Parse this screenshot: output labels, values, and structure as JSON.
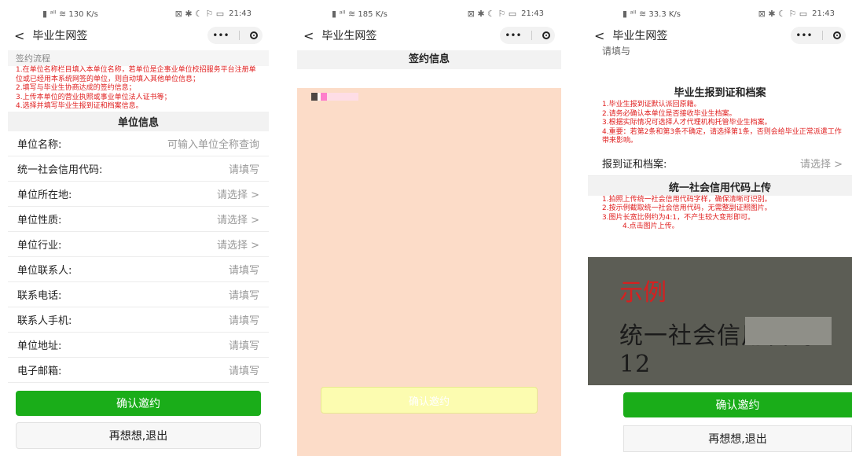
{
  "status": {
    "time": "21:43",
    "speed1": "130 K/s",
    "speed2": "185 K/s",
    "speed3": "33.3 K/s"
  },
  "nav": {
    "back_glyph": "<",
    "title": "毕业生网签",
    "more_glyph": "•••"
  },
  "panel1": {
    "process_label": "签约流程",
    "instructions": [
      "1.在单位名称栏目填入本单位名称，若单位是企事业单位校招服务平台注册单位或已经用本系统网签的单位，则自动填入其他单位信息；",
      "2.填写与毕业生协商达成的签约信息；",
      "3.上传本单位的营业执照或事业单位法人证书等；",
      "4.选择并填写毕业生报到证和档案信息。"
    ],
    "section_title": "单位信息",
    "rows": [
      {
        "label": "单位名称:",
        "value": "可输入单位全称查询"
      },
      {
        "label": "统一社会信用代码:",
        "value": "请填写"
      },
      {
        "label": "单位所在地:",
        "value": "请选择 >"
      },
      {
        "label": "单位性质:",
        "value": "请选择 >"
      },
      {
        "label": "单位行业:",
        "value": "请选择 >"
      },
      {
        "label": "单位联系人:",
        "value": "请填写"
      },
      {
        "label": "联系电话:",
        "value": "请填写"
      },
      {
        "label": "联系人手机:",
        "value": "请填写"
      },
      {
        "label": "单位地址:",
        "value": "请填写"
      },
      {
        "label": "电子邮箱:",
        "value": "请填写"
      }
    ],
    "confirm_button": "确认邀约",
    "exit_button": "再想想,退出"
  },
  "panel2": {
    "section_title": "签约信息",
    "noise_text": "BC",
    "ghost_button": "确认邀约"
  },
  "panel3": {
    "top_text": "请填与",
    "report_title": "毕业生报到证和档案",
    "report_notes": [
      "1.毕业生报到证默认派回原籍。",
      "2.请务必确认本单位是否接收毕业生档案。",
      "3.根据实际情况可选择人才代理机构托管毕业生档案。",
      "4.重要：若第2条和第3条不确定，请选择第1条，否则会给毕业正常派遣工作带来影响。"
    ],
    "report_row": {
      "label": "报到证和档案:",
      "value": "请选择 >"
    },
    "upload_title": "统一社会信用代码上传",
    "upload_notes": [
      "1.拍照上传统一社会信用代码字样，确保清晰可识别。",
      "2.按示例截取统一社会信用代码，无需整副证照图片。",
      "3.图片长宽比例约为4:1，不产生较大变形即可。",
      "4.点击图片上传。"
    ],
    "example_tag": "示例",
    "example_text": "统一社会信用代码 12",
    "confirm_button": "确认邀约",
    "exit_button": "再想想,退出"
  }
}
